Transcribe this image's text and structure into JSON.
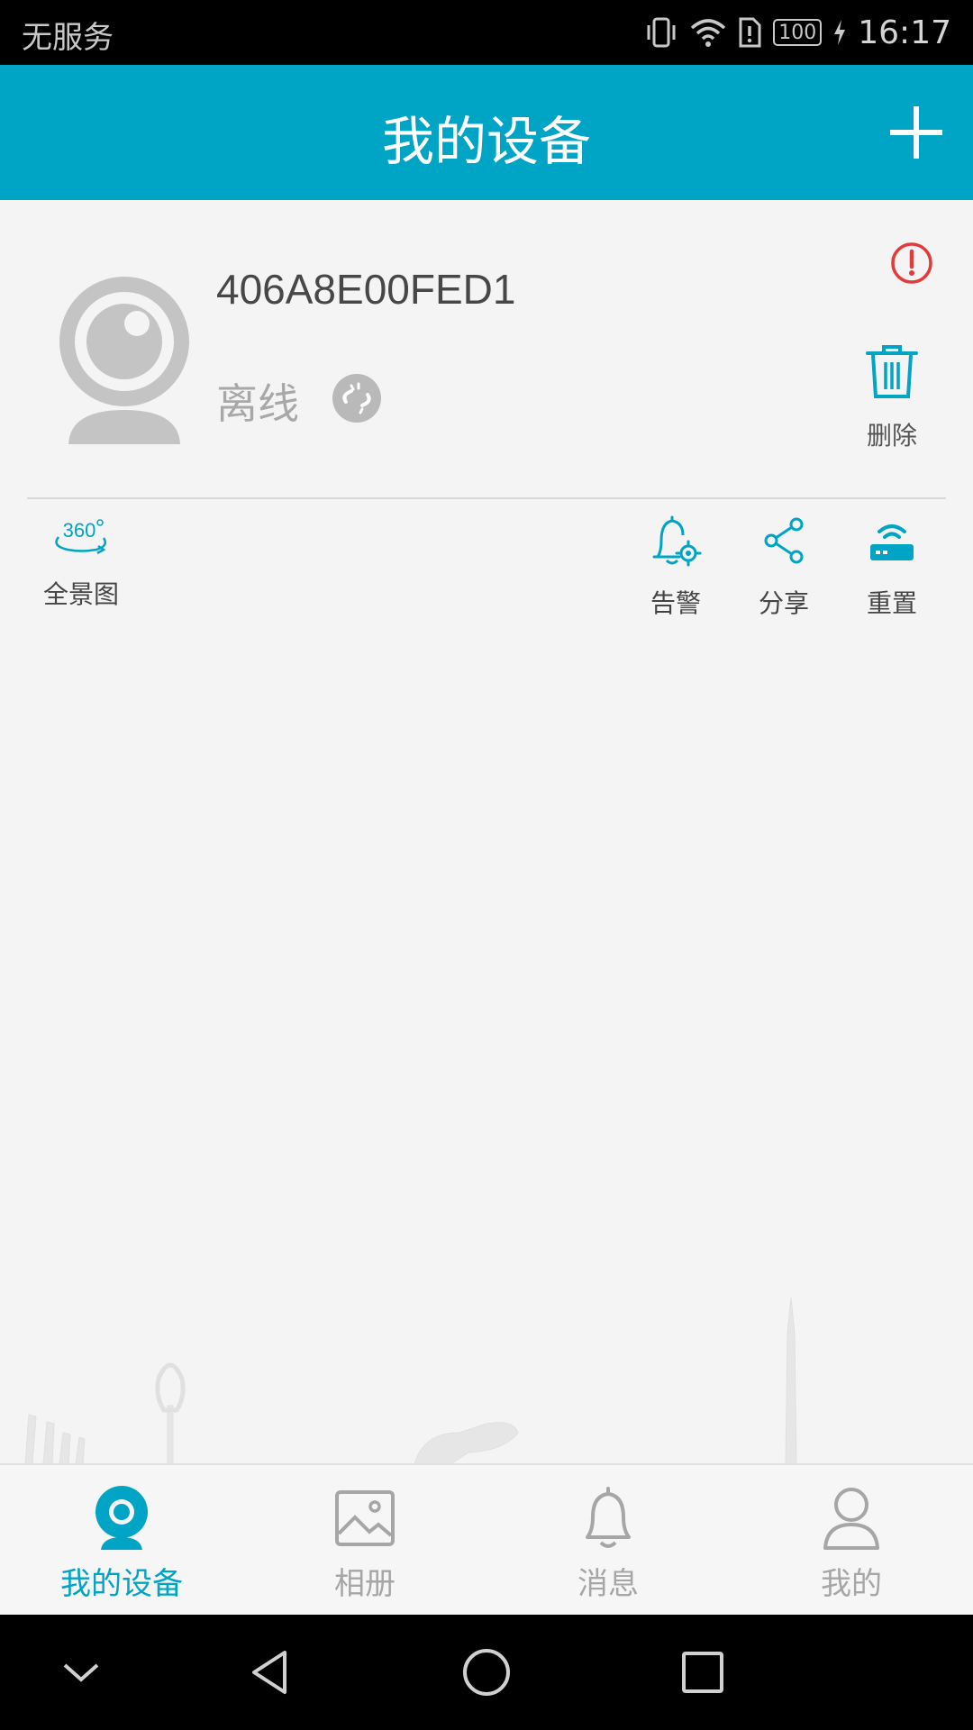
{
  "status_bar": {
    "carrier": "无服务",
    "battery": "100",
    "time": "16:17"
  },
  "header": {
    "title": "我的设备",
    "add_icon": "plus-icon"
  },
  "device": {
    "id": "406A8E00FED1",
    "status": "离线",
    "delete_label": "删除",
    "icons": [
      "camera-avatar-icon",
      "offline-link-icon",
      "alert-icon",
      "trash-icon"
    ]
  },
  "actions": {
    "panorama": {
      "label": "全景图",
      "icon": "panorama-360-icon",
      "badge": "360"
    },
    "alarm": {
      "label": "告警",
      "icon": "bell-gear-icon"
    },
    "share": {
      "label": "分享",
      "icon": "share-icon"
    },
    "reset": {
      "label": "重置",
      "icon": "router-icon"
    }
  },
  "bottom_nav": {
    "items": [
      {
        "label": "我的设备",
        "icon": "camera-icon",
        "active": true
      },
      {
        "label": "相册",
        "icon": "album-icon",
        "active": false
      },
      {
        "label": "消息",
        "icon": "bell-icon",
        "active": false
      },
      {
        "label": "我的",
        "icon": "person-icon",
        "active": false
      }
    ]
  },
  "colors": {
    "primary": "#00a5c6",
    "alert": "#e33b3b",
    "inactive": "#a6a6a6",
    "background": "#f4f4f4"
  }
}
